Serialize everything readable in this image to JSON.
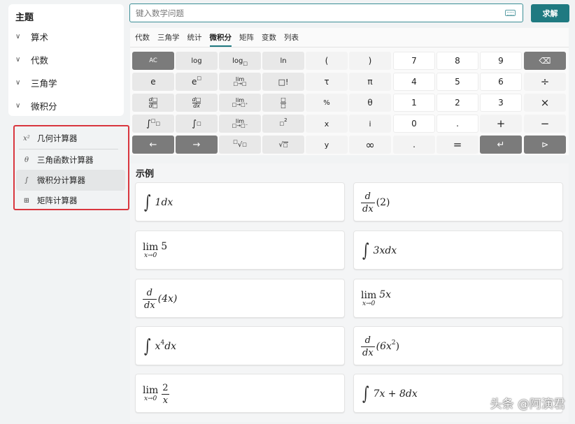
{
  "sidebar": {
    "title": "主题",
    "topics": [
      {
        "label": "算术"
      },
      {
        "label": "代数"
      },
      {
        "label": "三角学"
      },
      {
        "label": "微积分"
      }
    ],
    "tools": [
      {
        "icon": "x²",
        "label": "几何计算器"
      },
      {
        "icon": "θ",
        "label": "三角函数计算器"
      },
      {
        "icon": "∫",
        "label": "微积分计算器"
      },
      {
        "icon": "⊞",
        "label": "矩阵计算器"
      }
    ]
  },
  "search": {
    "placeholder": "键入数学问题",
    "value": ""
  },
  "solve_label": "求解",
  "tabs": [
    "代数",
    "三角学",
    "统计",
    "微积分",
    "矩阵",
    "变数",
    "列表"
  ],
  "active_tab": "微积分",
  "keys": {
    "ac": "AC",
    "log": "log",
    "logn": "log",
    "ln": "ln",
    "lparen": "(",
    "rparen": ")",
    "e": "e",
    "epow": "e",
    "lim": "lim",
    "fact": "□!",
    "tau": "τ",
    "pi": "π",
    "theta": "θ",
    "x": "x",
    "i": "i",
    "y": "y",
    "infinity": "∞",
    "percent": "%",
    "n7": "7",
    "n8": "8",
    "n9": "9",
    "n4": "4",
    "n5": "5",
    "n6": "6",
    "n1": "1",
    "n2": "2",
    "n3": "3",
    "n0": "0",
    "dot": ".",
    "dot2": ".",
    "divide": "÷",
    "times": "×",
    "plus": "+",
    "minus": "−",
    "equals": "=",
    "left": "←",
    "right": "→",
    "backspace": "⌫",
    "enter": "↵",
    "send": "⊳"
  },
  "examples_title": "示例",
  "examples": {
    "e1": {
      "body": "1dx"
    },
    "e2": {
      "num": "d",
      "den": "dx",
      "arg": "(2)"
    },
    "e3": {
      "word": "lim",
      "sub": "x→0",
      "expr": "5"
    },
    "e4": {
      "body": "3xdx"
    },
    "e5": {
      "num": "d",
      "den": "dx",
      "arg": "(4x)"
    },
    "e6": {
      "word": "lim",
      "sub": "x→0",
      "expr": "5x"
    },
    "e7": {
      "base": "x",
      "exp": "4",
      "tail": "dx"
    },
    "e8": {
      "num": "d",
      "den": "dx",
      "arg": "(6x",
      "exp": "2",
      "close": ")"
    },
    "e9": {
      "word": "lim",
      "sub": "x→0",
      "fnum": "2",
      "fden": "x"
    },
    "e10": {
      "body": "7x + 8dx"
    }
  },
  "watermark": "头条 @阿演君",
  "colors": {
    "accent": "#1f7a81",
    "highlight_border": "#d9363e",
    "dark_key": "#7b7b7b"
  }
}
